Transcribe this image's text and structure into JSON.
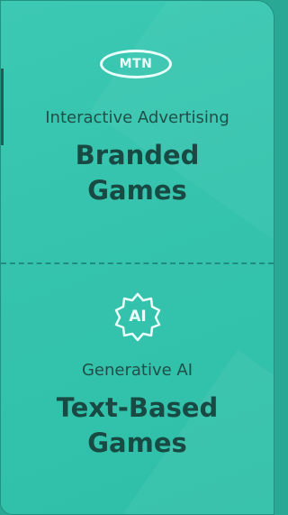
{
  "cards": [
    {
      "badge": "MTN",
      "badge_shape": "oval",
      "subtitle": "Interactive Advertising",
      "title_line1": "Branded",
      "title_line2": "Games"
    },
    {
      "badge": "AI",
      "badge_shape": "star",
      "subtitle": "Generative AI",
      "title_line1": "Text-Based",
      "title_line2": "Games"
    }
  ],
  "colors": {
    "card_background": "#35c3ad",
    "title_text": "#184a43",
    "badge_outline": "#eafffb",
    "divider": "#1f8c80"
  }
}
